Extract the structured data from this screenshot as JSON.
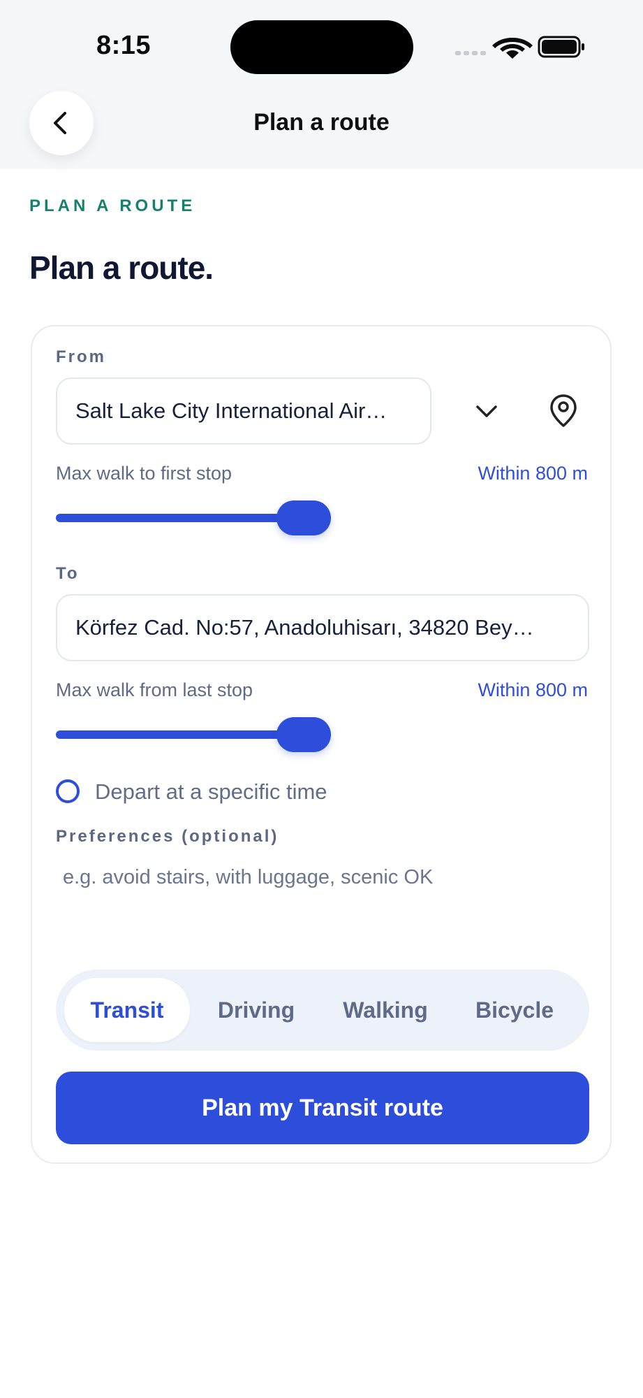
{
  "status_bar": {
    "time": "8:15"
  },
  "nav": {
    "title": "Plan a route",
    "back_icon": "chevron-left-icon"
  },
  "header": {
    "eyebrow": "PLAN A ROUTE",
    "heading": "Plan a route."
  },
  "form": {
    "from": {
      "label": "From",
      "value": "Salt Lake City International Air…",
      "dropdown_icon": "chevron-down-icon",
      "location_icon": "map-pin-icon",
      "walk_label": "Max walk to first stop",
      "walk_value": "Within 800 m",
      "walk_slider_level": 1.0
    },
    "to": {
      "label": "To",
      "value": "Körfez Cad. No:57, Anadoluhisarı, 34820 Bey…",
      "walk_label": "Max walk from last stop",
      "walk_value": "Within 800 m",
      "walk_slider_level": 1.0
    },
    "depart_option": {
      "label": "Depart at a specific time",
      "checked": false
    },
    "preferences": {
      "label": "Preferences (optional)",
      "placeholder": "e.g. avoid stairs, with luggage, scenic OK"
    },
    "modes": {
      "selected": "Transit",
      "options": [
        "Transit",
        "Driving",
        "Walking",
        "Bicycle"
      ]
    },
    "submit_label": "Plan my Transit route"
  },
  "colors": {
    "accent": "#2d4ddb",
    "eyebrow": "#16806e",
    "heading": "#0f1733"
  }
}
